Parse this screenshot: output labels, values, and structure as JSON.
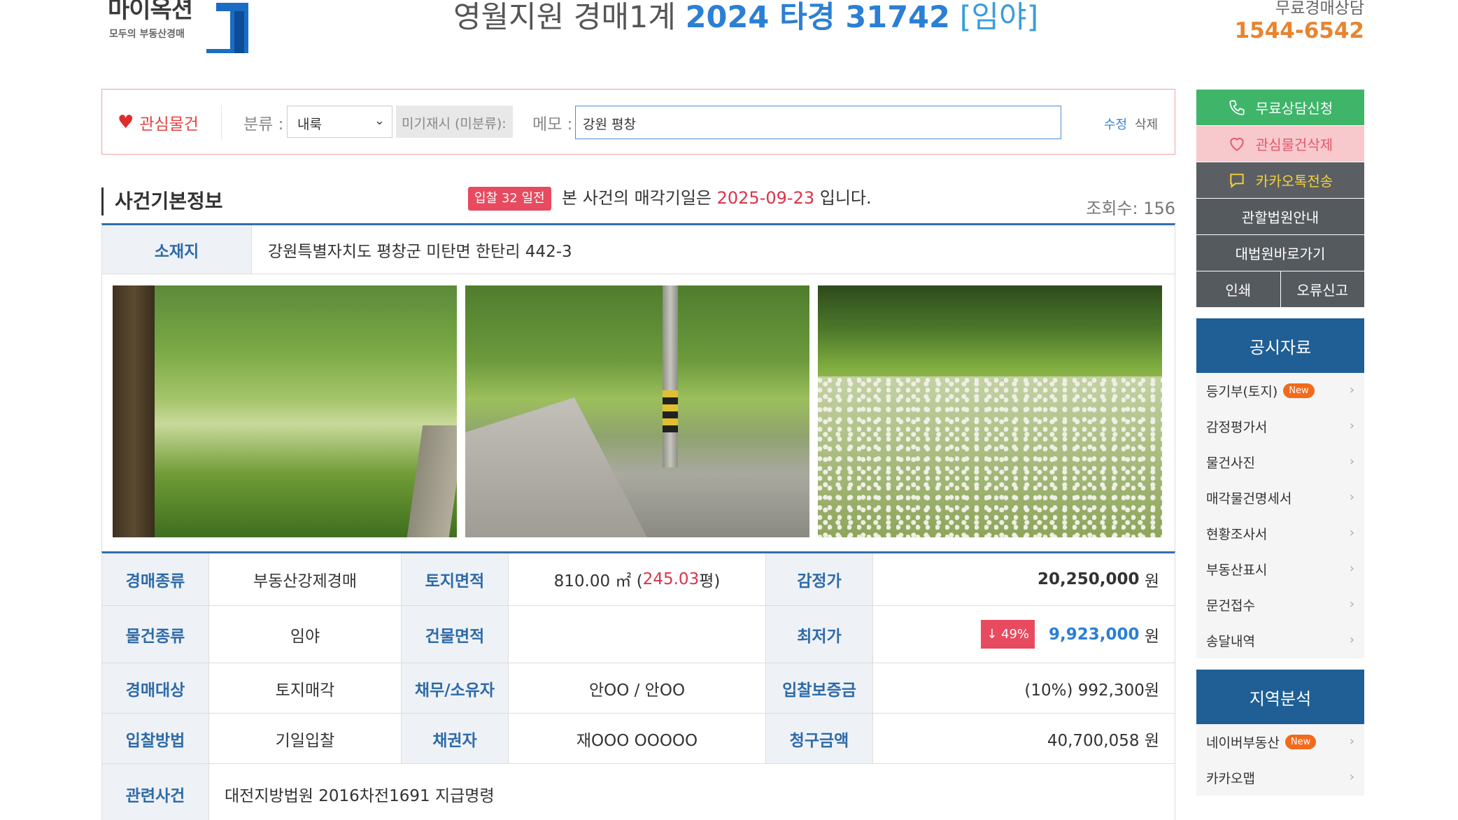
{
  "header": {
    "logo_text": "마이옥션",
    "logo_sub": "모두의 부동산경매",
    "court_prefix": "영월지원 경매1계",
    "case_number": "2024 타경 31742",
    "case_type": "[임야]",
    "consult_label": "무료경매상담",
    "consult_tel": "1544-6542"
  },
  "favbar": {
    "fav_label": "관심물건",
    "category_label": "분류 :",
    "category_value": "내룩",
    "unclassified": "미기재시 (미분류):",
    "memo_label": "메모 :",
    "memo_value": "강원 평창",
    "edit_label": "수정",
    "delete_label": "삭제"
  },
  "section": {
    "title": "사건기본정보",
    "dday_badge": "입찰 32 일전",
    "sale_prefix": "본 사건의 매각기일은",
    "sale_date": "2025-09-23",
    "sale_suffix": "입니다.",
    "views": "조회수: 156"
  },
  "address": {
    "label": "소재지",
    "value": "강원특별자치도 평창군 미탄면 한탄리 442-3"
  },
  "info": {
    "auction_type_label": "경매종류",
    "auction_type": "부동산강제경매",
    "land_area_label": "토지면적",
    "land_area_m2": "810.00 ㎡ (",
    "land_area_py": "245.03",
    "land_area_unit": "평)",
    "appraisal_label": "감정가",
    "appraisal": "20,250,000",
    "won": "원",
    "item_type_label": "물건종류",
    "item_type": "임야",
    "building_area_label": "건물면적",
    "building_area": "",
    "min_price_label": "최저가",
    "drop_badge": "↓ 49%",
    "min_price": "9,923,000",
    "target_label": "경매대상",
    "target": "토지매각",
    "debtor_label": "채무/소유자",
    "debtor": "안OO / 안OO",
    "deposit_label": "입찰보증금",
    "deposit": "(10%) 992,300원",
    "bid_method_label": "입찰방법",
    "bid_method": "기일입찰",
    "creditor_label": "채권자",
    "creditor": "재OOO OOOOO",
    "claim_label": "청구금액",
    "claim": "40,700,058 원",
    "related_label": "관련사건",
    "related": "대전지방법원 2016차전1691 지급명령"
  },
  "sidebar": {
    "consult_btn": "무료상담신청",
    "fav_delete_btn": "관심물건삭제",
    "kakao_btn": "카카오톡전송",
    "court_info_btn": "관할법원안내",
    "supreme_btn": "대법원바로가기",
    "print_btn": "인쇄",
    "error_btn": "오류신고",
    "docs_title": "공시자료",
    "docs": [
      "등기부(토지)",
      "감정평가서",
      "물건사진",
      "매각물건명세서",
      "현황조사서",
      "부동산표시",
      "문건접수",
      "송달내역"
    ],
    "new_badge": "New",
    "region_title": "지역분석",
    "region": [
      "네이버부동산",
      "카카오맵"
    ]
  },
  "colors": {
    "accent_blue": "#2b7fd4",
    "header_blue": "#1f5f95",
    "red": "#d9334a",
    "orange": "#e8842f",
    "green": "#3fb56a"
  }
}
